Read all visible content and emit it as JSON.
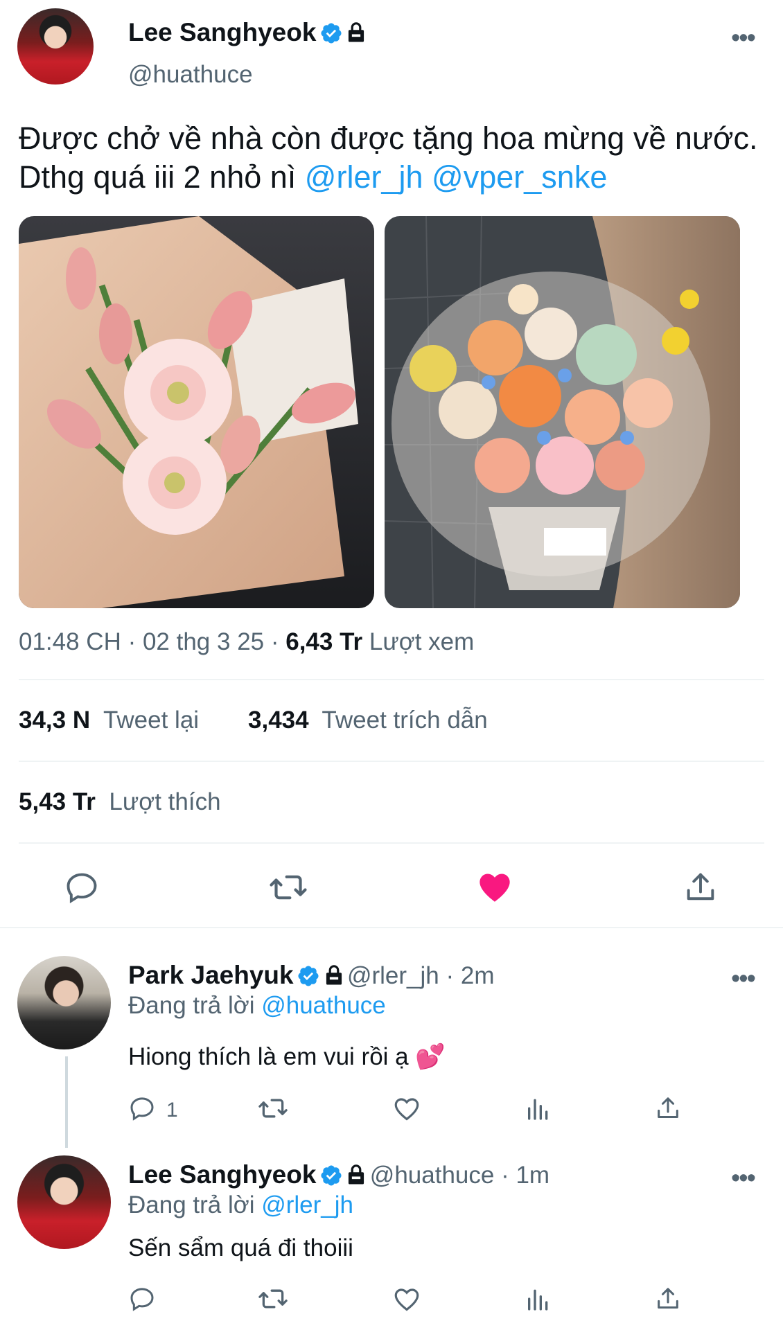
{
  "tweet": {
    "author_name": "Lee Sanghyeok",
    "author_handle": "@huathuce",
    "text_main": "Được chở về nhà còn được tặng hoa mừng về nước. Dthg quá iii 2 nhỏ nì",
    "mention_1": "@rler_jh",
    "mention_2": "@vper_snke",
    "time": "01:48 CH · 02 thg 3 25 ·",
    "views_count": "6,43 Tr",
    "views_label": "Lượt xem",
    "retweet_count": "34,3 N",
    "retweet_label": "Tweet lại",
    "quote_count": "3,434",
    "quote_label": "Tweet trích dẫn",
    "like_count": "5,43 Tr",
    "like_label": "Lượt thích"
  },
  "reply_1": {
    "author_name": "Park Jaehyuk",
    "handle_time": "@rler_jh · 2m",
    "replying_prefix": "Đang trả lời",
    "replying_to": "@huathuce",
    "text": "Hiong thích là em vui rồi ạ",
    "emoji": "💕",
    "reply_count": "1"
  },
  "reply_2": {
    "author_name": "Lee Sanghyeok",
    "handle_time": "@huathuce · 1m",
    "replying_prefix": "Đang trả lời",
    "replying_to": "@rler_jh",
    "text": "Sến sẩm quá đi thoiii"
  },
  "colors": {
    "accent": "#1d9bf0",
    "like": "#f91880",
    "text_secondary": "#536471"
  },
  "icons": [
    "verified-badge-icon",
    "lock-icon",
    "more-icon",
    "reply-icon",
    "retweet-icon",
    "like-icon",
    "share-icon",
    "views-icon"
  ]
}
